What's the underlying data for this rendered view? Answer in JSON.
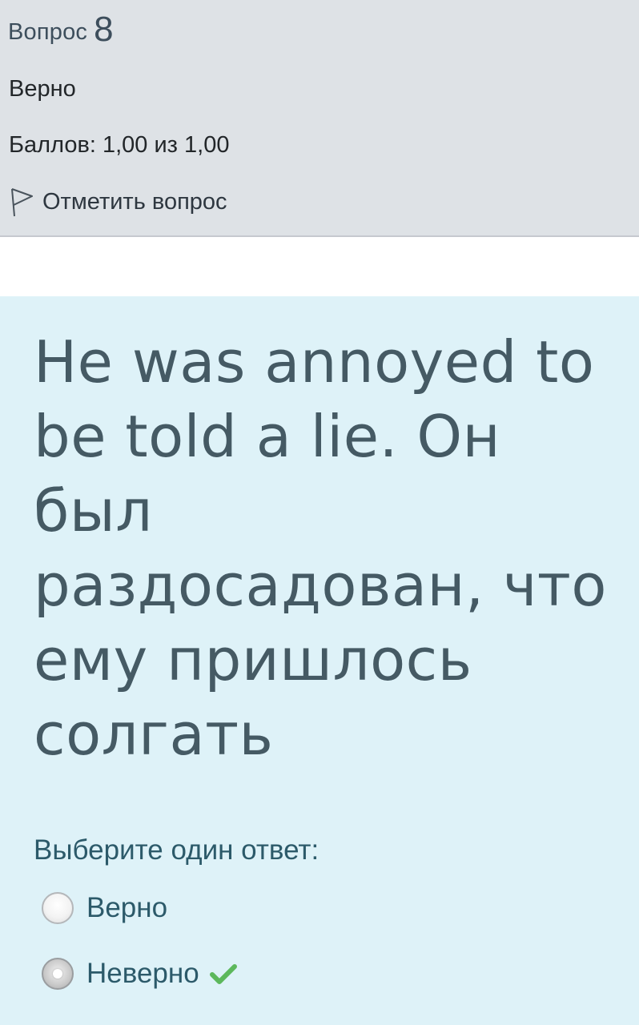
{
  "info": {
    "question_label": "Вопрос",
    "question_number": "8",
    "state": "Верно",
    "grade": "Баллов: 1,00 из 1,00",
    "flag_label": "Отметить вопрос",
    "flag_icon": "flag-outline-icon"
  },
  "question": {
    "text": "He was annoyed to be told a lie. Он был раздосадован, что ему пришлось солгать",
    "prompt": "Выберите один ответ:",
    "answers": [
      {
        "label": "Верно",
        "selected": false
      },
      {
        "label": "Неверно",
        "selected": true,
        "mark": "check-icon"
      }
    ]
  },
  "colors": {
    "info_bg": "#dee2e6",
    "content_bg": "#def2f8",
    "question_text": "#455a64",
    "answer_text": "#2c5a6a",
    "correct_check": "#5cb85c"
  }
}
